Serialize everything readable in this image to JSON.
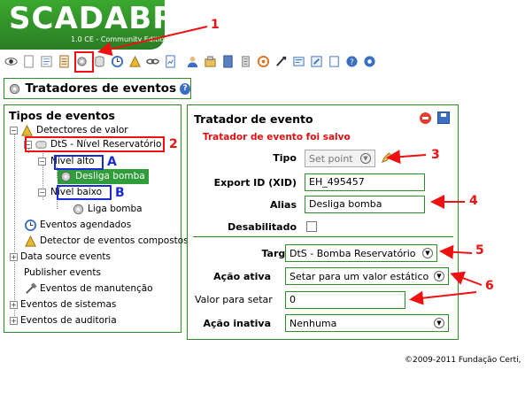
{
  "header": {
    "logo_text": "SCADABR",
    "version_text": "1.0 CE - Community Edition"
  },
  "toolbar": {
    "icons": [
      "eye-icon",
      "blank-page-icon",
      "watchlist-icon",
      "list-icon",
      "event-handler-gear-icon",
      "datasource-icon",
      "scheduled-clock-icon",
      "compound-events-icon",
      "link-icon",
      "reports-icon",
      "users-icon",
      "cameras-icon",
      "sql-icon",
      "emport-icon",
      "maintenance-icon",
      "mailing-icon",
      "script-icon",
      "publisher-icon",
      "help-icon",
      "logout-icon"
    ]
  },
  "page": {
    "title": "Tratadores de eventos"
  },
  "tree": {
    "title": "Tipos de eventos",
    "items": {
      "detectores": "Detectores de valor",
      "dts": "DtS - Nível Reservatório",
      "nivel_alto": "Nível alto",
      "desliga": "Desliga bomba",
      "nivel_baixo": "Nível baixo",
      "liga": "Liga bomba",
      "agendados": "Eventos agendados",
      "compostos": "Detector de eventos compostos",
      "data_source": "Data source events",
      "publisher": "Publisher events",
      "manutencao": "Eventos de manutenção",
      "sistemas": "Eventos de sistemas",
      "auditoria": "Eventos de auditoria"
    }
  },
  "form": {
    "title": "Tratador de evento",
    "saved_message": "Tratador de evento foi salvo",
    "tipo_label": "Tipo",
    "tipo_value": "Set point",
    "xid_label": "Export ID (XID)",
    "xid_value": "EH_495457",
    "alias_label": "Alias",
    "alias_value": "Desliga bomba",
    "desabilitado_label": "Desabilitado",
    "target_label": "Target",
    "target_value": "DtS - Bomba Reservatório",
    "acao_ativa_label": "Ação ativa",
    "acao_ativa_value": "Setar para um valor estático",
    "valor_label": "Valor para setar",
    "valor_value": "0",
    "acao_inativa_label": "Ação inativa",
    "acao_inativa_value": "Nenhuma"
  },
  "annotations": {
    "n1": "1",
    "n2": "2",
    "n3": "3",
    "n4": "4",
    "n5": "5",
    "n6": "6",
    "a": "A",
    "b": "B",
    "color_red": "#ee1111",
    "color_blue": "#1a2bd0"
  },
  "footer": {
    "copyright": "©2009-2011 Fundação Certi,"
  }
}
